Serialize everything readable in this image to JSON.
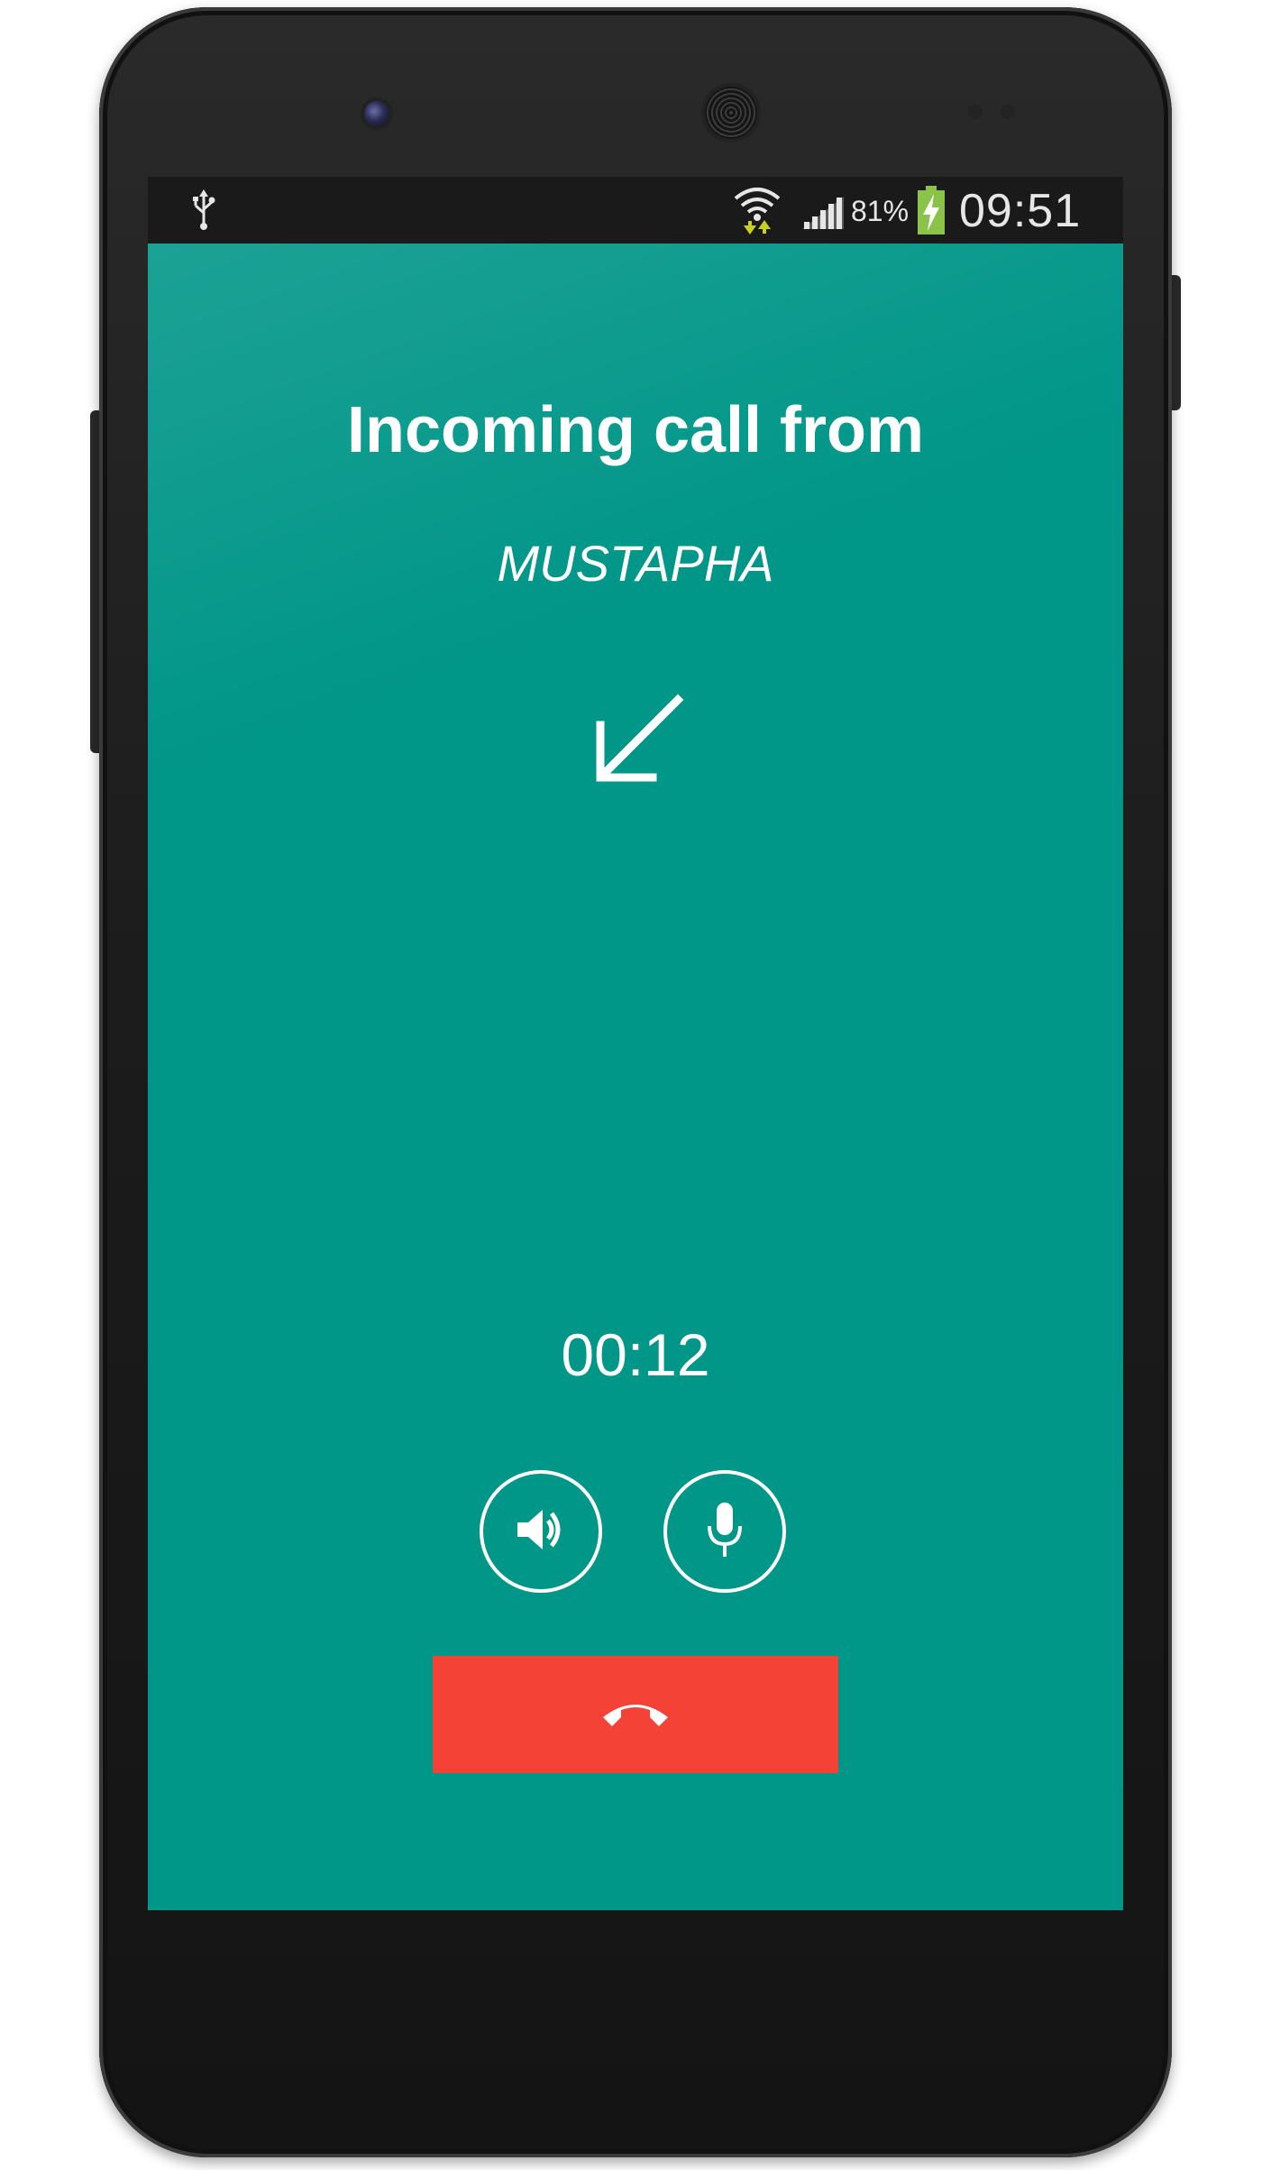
{
  "status_bar": {
    "battery_percent": "81%",
    "time": "09:51",
    "icons": [
      "usb-icon",
      "wifi-data-icon",
      "signal-icon",
      "battery-charging-icon"
    ]
  },
  "call": {
    "title": "Incoming call from",
    "caller": "MUSTAPHA",
    "direction_icon": "incoming-arrow-icon",
    "timer": "00:12"
  },
  "controls": {
    "speaker_icon": "speaker-icon",
    "mic_icon": "microphone-icon",
    "hangup_icon": "phone-hangup-icon"
  },
  "colors": {
    "screen_background": "#009688",
    "hangup_button": "#f44336",
    "status_bar": "#1a1a1a",
    "battery_green": "#8bc34a",
    "data_arrows": "#c8d21e"
  }
}
